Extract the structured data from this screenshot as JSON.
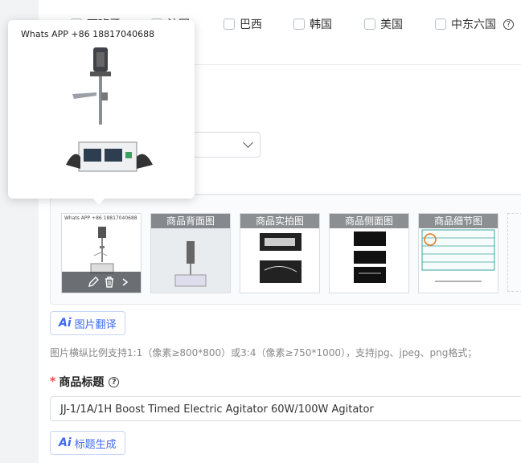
{
  "countries": [
    {
      "label": "西班牙"
    },
    {
      "label": "法国"
    },
    {
      "label": "巴西"
    },
    {
      "label": "韩国"
    },
    {
      "label": "美国"
    },
    {
      "label": "中东六国"
    }
  ],
  "popup": {
    "watermark": "Whats APP +86 18817040688"
  },
  "images": {
    "thumbs": [
      {
        "caption": "",
        "watermark": "Whats APP +86 18817040688"
      },
      {
        "caption": "商品背面图"
      },
      {
        "caption": "商品实拍图"
      },
      {
        "caption": "商品侧面图"
      },
      {
        "caption": "商品细节图"
      }
    ],
    "translate_label": "图片翻译",
    "hint": "图片横纵比例支持1:1（像素≥800*800）或3:4（像素≥750*1000），支持jpg、jpeg、png格式；"
  },
  "title_field": {
    "label": "商品标题",
    "value": "JJ-1/1A/1H Boost Timed Electric Agitator 60W/100W Agitator",
    "generate_label": "标题生成"
  },
  "ai_logo": "Ai",
  "colors": {
    "accent": "#3d6af2",
    "required": "#e84b3c"
  }
}
